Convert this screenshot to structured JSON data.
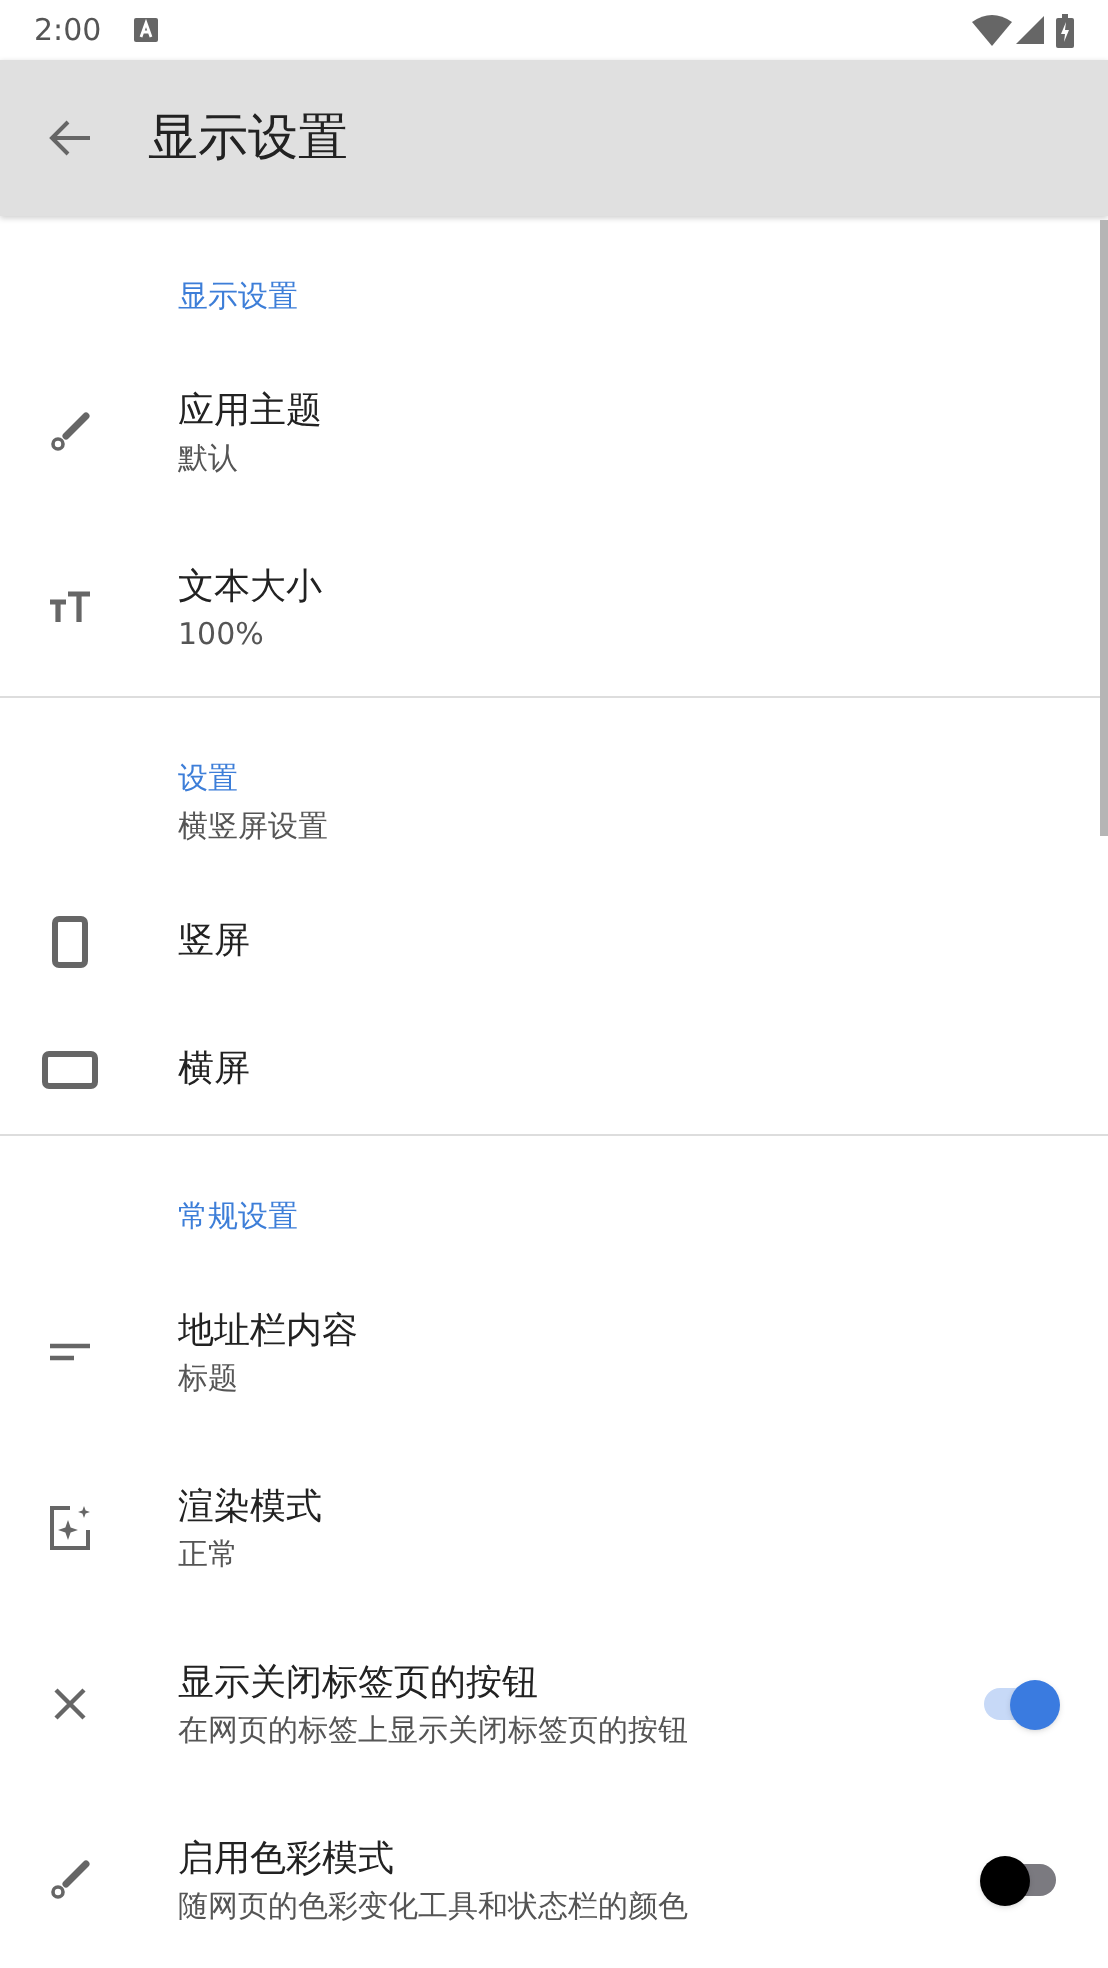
{
  "status_bar": {
    "time": "2:00"
  },
  "app_bar": {
    "title": "显示设置"
  },
  "sections": [
    {
      "header": "显示设置",
      "items": [
        {
          "kind": "value",
          "title": "应用主题",
          "summary": "默认"
        },
        {
          "kind": "value",
          "title": "文本大小",
          "summary": "100%"
        }
      ]
    },
    {
      "header": "设置",
      "summary": "横竖屏设置",
      "items": [
        {
          "kind": "plain",
          "title": "竖屏"
        },
        {
          "kind": "plain",
          "title": "横屏"
        }
      ]
    },
    {
      "header": "常规设置",
      "items": [
        {
          "kind": "value",
          "title": "地址栏内容",
          "summary": "标题"
        },
        {
          "kind": "value",
          "title": "渲染模式",
          "summary": "正常"
        },
        {
          "kind": "toggle",
          "title": "显示关闭标签页的按钮",
          "summary": "在网页的标签上显示关闭标签页的按钮",
          "on": true
        },
        {
          "kind": "toggle",
          "title": "启用色彩模式",
          "summary": "随网页的色彩变化工具和状态栏的颜色",
          "on": false
        }
      ]
    }
  ]
}
